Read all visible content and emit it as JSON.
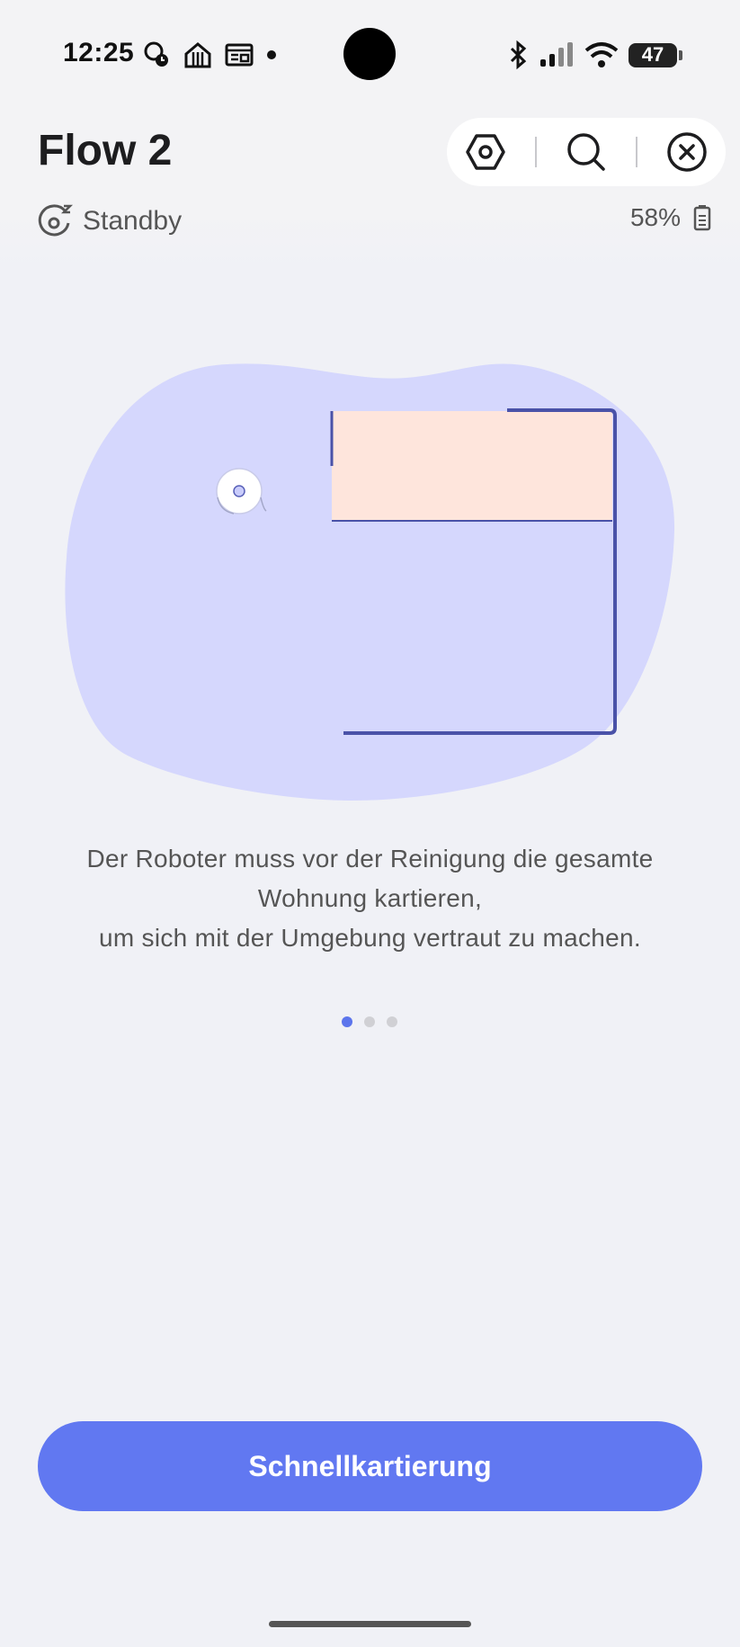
{
  "status_bar": {
    "time": "12:25",
    "battery_level": "47",
    "left_icons": [
      "notification-app-icon",
      "restaurant-icon",
      "news-icon",
      "dot-icon"
    ],
    "right_icons": [
      "bluetooth-icon",
      "cellular-signal-icon",
      "wifi-icon",
      "battery-icon"
    ]
  },
  "header": {
    "title": "Flow 2",
    "actions": [
      "settings-nut-icon",
      "search-icon",
      "close-icon"
    ]
  },
  "device_status": {
    "state": "Standby",
    "battery": "58%"
  },
  "onboarding": {
    "description_lines": [
      "Der Roboter muss vor der Reinigung die gesamte",
      "Wohnung kartieren,",
      "um sich mit der Umgebung vertraut zu machen."
    ],
    "page_count": 3,
    "active_page": 1
  },
  "primary_action": {
    "label": "Schnellkartierung"
  },
  "colors": {
    "accent": "#6178f1",
    "blob": "#d5d7fd",
    "room": "#fee5dc",
    "wall": "#4a52a8",
    "dot_active": "#5c75ec",
    "dot_inactive": "#d0d0d4"
  }
}
